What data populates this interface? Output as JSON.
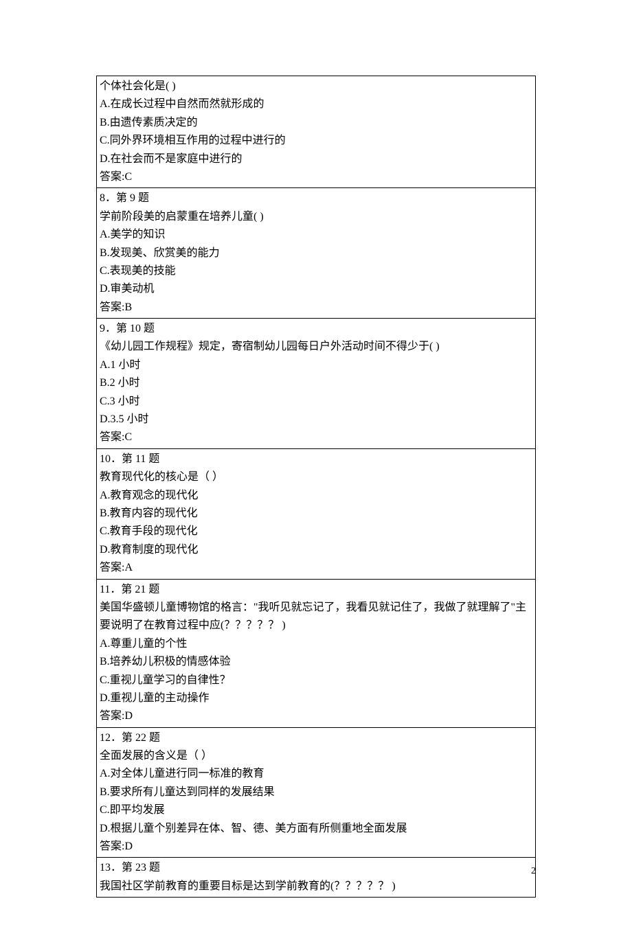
{
  "rows": [
    {
      "lines": [
        "个体社会化是( )",
        "A.在成长过程中自然而然就形成的",
        "B.由遗传素质决定的",
        "C.同外界环境相互作用的过程中进行的",
        "D.在社会而不是家庭中进行的",
        "答案:C"
      ]
    },
    {
      "lines": [
        "8．第 9 题",
        "学前阶段美的启蒙重在培养儿童( )",
        "A.美学的知识",
        "B.发现美、欣赏美的能力",
        "C.表现美的技能",
        "D.审美动机",
        "答案:B"
      ]
    },
    {
      "lines": [
        "9．第 10 题",
        "《幼儿园工作规程》规定，寄宿制幼儿园每日户外活动时间不得少于( )",
        "A.1 小时",
        "B.2 小时",
        "C.3 小时",
        "D.3.5 小时",
        "答案:C"
      ]
    },
    {
      "lines": [
        "10．第 11 题",
        "教育现代化的核心是（ ）",
        "A.教育观念的现代化",
        "B.教育内容的现代化",
        "C.教育手段的现代化",
        "D.教育制度的现代化",
        "答案:A"
      ]
    },
    {
      "lines": [
        "11．第 21 题",
        "美国华盛顿儿童博物馆的格言：\"我听见就忘记了，我看见就记住了，我做了就理解了\"主要说明了在教育过程中应(？？？？？  )",
        "A.尊重儿童的个性",
        "B.培养幼儿积极的情感体验",
        "C.重视儿童学习的自律性？",
        "D.重视儿童的主动操作",
        "答案:D"
      ]
    },
    {
      "lines": [
        "12．第 22 题",
        "全面发展的含义是（ ）",
        "A.对全体儿童进行同一标准的教育",
        "B.要求所有儿童达到同样的发展结果",
        "C.即平均发展",
        "D.根据儿童个别差异在体、智、德、美方面有所侧重地全面发展",
        "答案:D"
      ]
    },
    {
      "lines": [
        "13．第 23 题",
        "我国社区学前教育的重要目标是达到学前教育的(？？？？？  )"
      ]
    }
  ],
  "page_number": "2"
}
